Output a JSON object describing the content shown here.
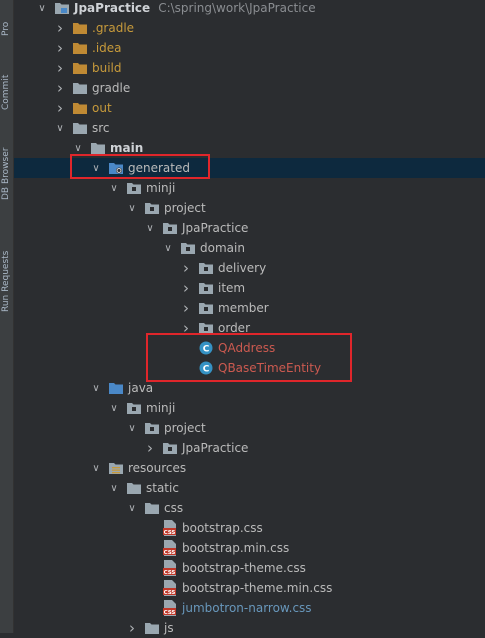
{
  "side_tabs": [
    "Pro",
    "Commit",
    "DB Browser",
    "Run Requests"
  ],
  "tree": [
    {
      "depth": 0,
      "arrow": "down",
      "icon": "module-folder-icon",
      "label": "JpaPractice",
      "path": "C:\\spring\\work\\JpaPractice",
      "style": "bold"
    },
    {
      "depth": 1,
      "arrow": "right",
      "icon": "folder-orange-icon",
      "label": ".gradle",
      "style": "orange"
    },
    {
      "depth": 1,
      "arrow": "right",
      "icon": "folder-orange-icon",
      "label": ".idea",
      "style": "orange"
    },
    {
      "depth": 1,
      "arrow": "right",
      "icon": "folder-orange-icon",
      "label": "build",
      "style": "orange"
    },
    {
      "depth": 1,
      "arrow": "right",
      "icon": "folder-icon",
      "label": "gradle",
      "style": "normal"
    },
    {
      "depth": 1,
      "arrow": "right",
      "icon": "folder-orange-icon",
      "label": "out",
      "style": "orange"
    },
    {
      "depth": 1,
      "arrow": "down",
      "icon": "folder-icon",
      "label": "src",
      "style": "normal"
    },
    {
      "depth": 2,
      "arrow": "down",
      "icon": "folder-icon",
      "label": "main",
      "style": "bold"
    },
    {
      "depth": 3,
      "arrow": "down",
      "icon": "generated-sources-folder-icon",
      "label": "generated",
      "style": "normal",
      "selected": true
    },
    {
      "depth": 4,
      "arrow": "down",
      "icon": "package-icon",
      "label": "minji",
      "style": "normal"
    },
    {
      "depth": 5,
      "arrow": "down",
      "icon": "package-icon",
      "label": "project",
      "style": "normal"
    },
    {
      "depth": 6,
      "arrow": "down",
      "icon": "package-icon",
      "label": "JpaPractice",
      "style": "normal"
    },
    {
      "depth": 7,
      "arrow": "down",
      "icon": "package-icon",
      "label": "domain",
      "style": "normal"
    },
    {
      "depth": 8,
      "arrow": "right",
      "icon": "package-icon",
      "label": "delivery",
      "style": "normal"
    },
    {
      "depth": 8,
      "arrow": "right",
      "icon": "package-icon",
      "label": "item",
      "style": "normal"
    },
    {
      "depth": 8,
      "arrow": "right",
      "icon": "package-icon",
      "label": "member",
      "style": "normal"
    },
    {
      "depth": 8,
      "arrow": "right",
      "icon": "package-icon",
      "label": "order",
      "style": "normal"
    },
    {
      "depth": 8,
      "arrow": "none",
      "icon": "class-icon",
      "label": "QAddress",
      "style": "red"
    },
    {
      "depth": 8,
      "arrow": "none",
      "icon": "class-icon",
      "label": "QBaseTimeEntity",
      "style": "red"
    },
    {
      "depth": 3,
      "arrow": "down",
      "icon": "source-folder-icon",
      "label": "java",
      "style": "normal"
    },
    {
      "depth": 4,
      "arrow": "down",
      "icon": "package-icon",
      "label": "minji",
      "style": "normal"
    },
    {
      "depth": 5,
      "arrow": "down",
      "icon": "package-icon",
      "label": "project",
      "style": "normal"
    },
    {
      "depth": 6,
      "arrow": "right",
      "icon": "package-icon",
      "label": "JpaPractice",
      "style": "normal"
    },
    {
      "depth": 3,
      "arrow": "down",
      "icon": "resources-folder-icon",
      "label": "resources",
      "style": "normal"
    },
    {
      "depth": 4,
      "arrow": "down",
      "icon": "folder-icon",
      "label": "static",
      "style": "normal"
    },
    {
      "depth": 5,
      "arrow": "down",
      "icon": "folder-icon",
      "label": "css",
      "style": "normal"
    },
    {
      "depth": 6,
      "arrow": "none",
      "icon": "css-file-icon",
      "label": "bootstrap.css",
      "style": "normal"
    },
    {
      "depth": 6,
      "arrow": "none",
      "icon": "css-file-icon",
      "label": "bootstrap.min.css",
      "style": "normal"
    },
    {
      "depth": 6,
      "arrow": "none",
      "icon": "css-file-icon",
      "label": "bootstrap-theme.css",
      "style": "normal"
    },
    {
      "depth": 6,
      "arrow": "none",
      "icon": "css-file-icon",
      "label": "bootstrap-theme.min.css",
      "style": "normal"
    },
    {
      "depth": 6,
      "arrow": "none",
      "icon": "css-file-icon",
      "label": "jumbotron-narrow.css",
      "style": "blue"
    },
    {
      "depth": 5,
      "arrow": "right",
      "icon": "folder-icon",
      "label": "js",
      "style": "normal"
    }
  ],
  "colors": {
    "background": "#2b2d30",
    "selected_row": "#0d293e",
    "highlight_box": "#e0262b",
    "excluded_text": "#c79a3b",
    "generated_class_text": "#cc5a50",
    "modified_text": "#6897bb"
  }
}
